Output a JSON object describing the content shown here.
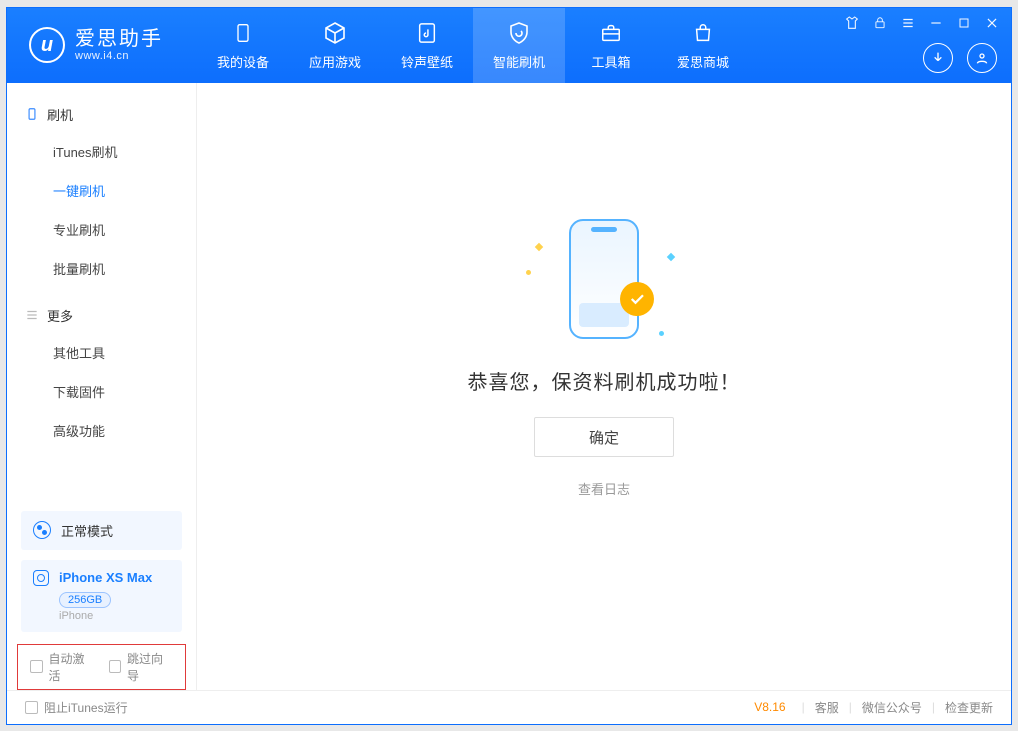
{
  "app": {
    "name_cn": "爱思助手",
    "name_en": "www.i4.cn",
    "logo_letter": "u"
  },
  "tabs": {
    "device": "我的设备",
    "apps": "应用游戏",
    "ring": "铃声壁纸",
    "flash": "智能刷机",
    "tools": "工具箱",
    "store": "爱思商城"
  },
  "sidebar": {
    "group_flash": "刷机",
    "items_flash": {
      "itunes": "iTunes刷机",
      "onekey": "一键刷机",
      "pro": "专业刷机",
      "batch": "批量刷机"
    },
    "group_more": "更多",
    "items_more": {
      "other": "其他工具",
      "fw": "下载固件",
      "adv": "高级功能"
    },
    "mode": "正常模式",
    "device": {
      "name": "iPhone XS Max",
      "capacity": "256GB",
      "type": "iPhone"
    },
    "opts": {
      "auto_activate": "自动激活",
      "skip_guide": "跳过向导"
    }
  },
  "result": {
    "message": "恭喜您，保资料刷机成功啦！",
    "ok": "确定",
    "log": "查看日志"
  },
  "status": {
    "block_itunes": "阻止iTunes运行",
    "version": "V8.16",
    "cs": "客服",
    "wechat": "微信公众号",
    "update": "检查更新"
  }
}
